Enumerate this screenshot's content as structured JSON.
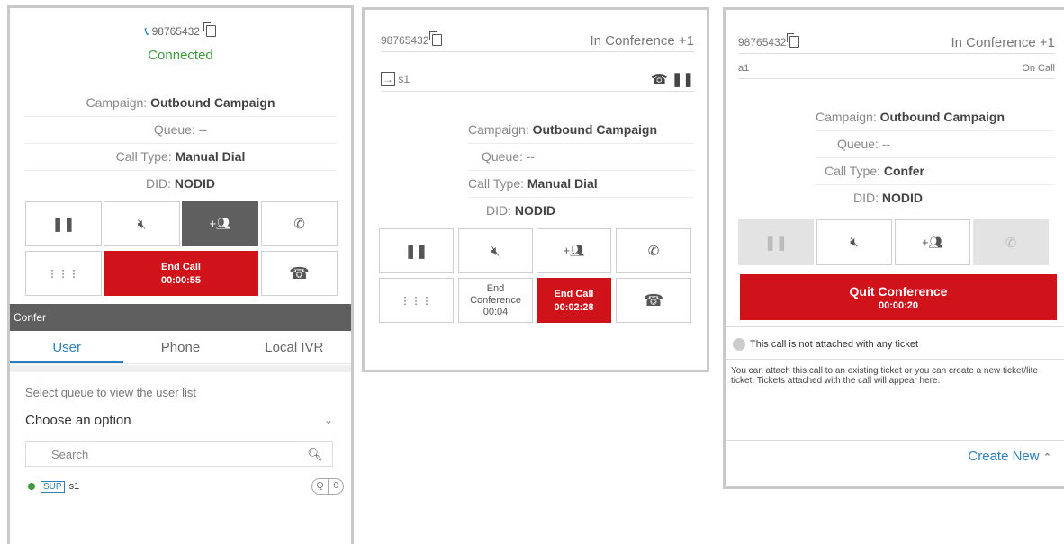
{
  "colors": {
    "green": "#3d9a3d",
    "red": "#d0121b",
    "dark": "#5f5f5f",
    "link": "#2f7fb8"
  },
  "panel1": {
    "phone": "98765432",
    "status": "Connected",
    "campaign_label": "Campaign:",
    "campaign_value": "Outbound Campaign",
    "queue_label": "Queue:",
    "queue_value": "--",
    "calltype_label": "Call Type:",
    "calltype_value": "Manual Dial",
    "did_label": "DID:",
    "did_value": "NODID",
    "end_call_label": "End Call",
    "end_call_timer": "00:00:55",
    "section_title": "Confer",
    "tabs": [
      "User",
      "Phone",
      "Local IVR"
    ],
    "queue_prompt": "Select queue to view the user list",
    "select_value": "Choose an option",
    "search_placeholder": "Search",
    "user_badge": "SUP",
    "user_name": "s1",
    "user_action_q": "Q",
    "user_action_0": "0"
  },
  "panel2": {
    "phone": "98765432",
    "conf_status": "In Conference +1",
    "leg_name": "s1",
    "campaign_label": "Campaign:",
    "campaign_value": "Outbound Campaign",
    "queue_label": "Queue:",
    "queue_value": "--",
    "calltype_label": "Call Type:",
    "calltype_value": "Manual Dial",
    "did_label": "DID:",
    "did_value": "NODID",
    "end_conf_label1": "End",
    "end_conf_label2": "Conference",
    "end_conf_timer": "00:04",
    "end_call_label": "End Call",
    "end_call_timer": "00:02:28"
  },
  "panel3": {
    "phone": "98765432",
    "conf_status": "In Conference +1",
    "leg_name": "a1",
    "leg_status": "On Call",
    "campaign_label": "Campaign:",
    "campaign_value": "Outbound Campaign",
    "queue_label": "Queue:",
    "queue_value": "--",
    "calltype_label": "Call Type:",
    "calltype_value": "Confer",
    "did_label": "DID:",
    "did_value": "NODID",
    "quit_label": "Quit Conference",
    "quit_timer": "00:00:20",
    "ticket_notice": "This call is not attached with any ticket",
    "ticket_help": "You can attach this call to an existing ticket or you can create a new ticket/lite ticket. Tickets attached with the call will appear here.",
    "create_new": "Create New"
  }
}
